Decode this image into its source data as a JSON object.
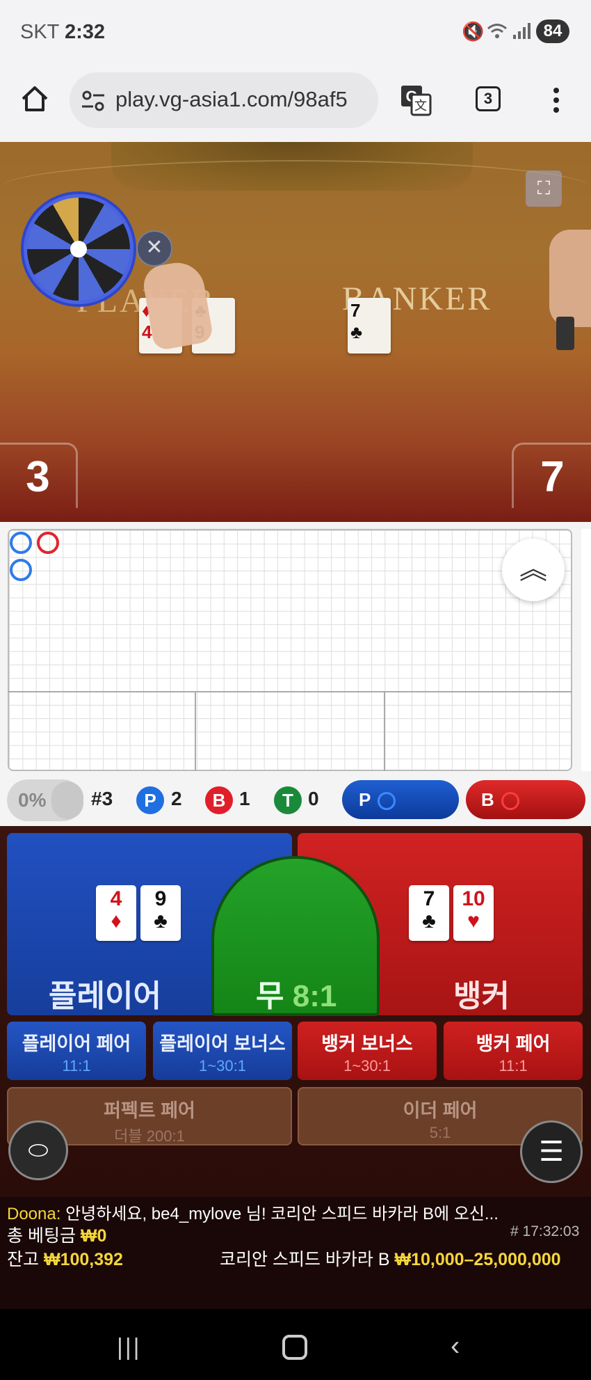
{
  "status_bar": {
    "carrier": "SKT",
    "time": "2:32",
    "battery": "84",
    "icons": [
      "mute-icon",
      "wifi-icon",
      "signal-icon",
      "battery-icon"
    ]
  },
  "browser": {
    "url": "play.vg-asia1.com/98af5",
    "tab_count": "3"
  },
  "video": {
    "player_label": "PLAYER",
    "banker_label": "BANKER",
    "player_score": "3",
    "banker_score": "7"
  },
  "stats": {
    "percent": "0%",
    "round": "#3",
    "player_letter": "P",
    "player_count": "2",
    "banker_letter": "B",
    "banker_count": "1",
    "tie_letter": "T",
    "tie_count": "0",
    "predict_player": "P",
    "predict_banker": "B",
    "colors": {
      "player": "#1f6fe0",
      "banker": "#e01f2a",
      "tie": "#1a8a3a"
    }
  },
  "betting": {
    "player": {
      "title": "플레이어",
      "cards": [
        {
          "rank": "4",
          "suit": "♦",
          "color": "red"
        },
        {
          "rank": "9",
          "suit": "♣",
          "color": "black"
        }
      ]
    },
    "tie": {
      "title": "무",
      "odds": "8:1"
    },
    "banker": {
      "title": "뱅커",
      "cards": [
        {
          "rank": "7",
          "suit": "♣",
          "color": "black"
        },
        {
          "rank": "10",
          "suit": "♥",
          "color": "red"
        }
      ]
    },
    "side_bets": [
      {
        "name": "플레이어 페어",
        "odds": "11:1"
      },
      {
        "name": "플레이어 보너스",
        "odds": "1~30:1"
      },
      {
        "name": "뱅커 보너스",
        "odds": "1~30:1"
      },
      {
        "name": "뱅커 페어",
        "odds": "11:1"
      },
      {
        "name": "퍼펙트 페어",
        "odds": "더블 200:1"
      },
      {
        "name": "이더 페어",
        "odds": "5:1"
      }
    ]
  },
  "info": {
    "chat_user": "Doona:",
    "chat_message": "안녕하세요, be4_mylove 님! 코리안 스피드 바카라 B에 오신...",
    "total_bet_label": "총 베팅금",
    "total_bet_value": "₩0",
    "game_time": "# 17:32:03",
    "balance_label": "잔고",
    "balance_value": "₩100,392",
    "table_name": "코리안 스피드 바카라 B",
    "table_limits": "₩10,000–25,000,000"
  }
}
